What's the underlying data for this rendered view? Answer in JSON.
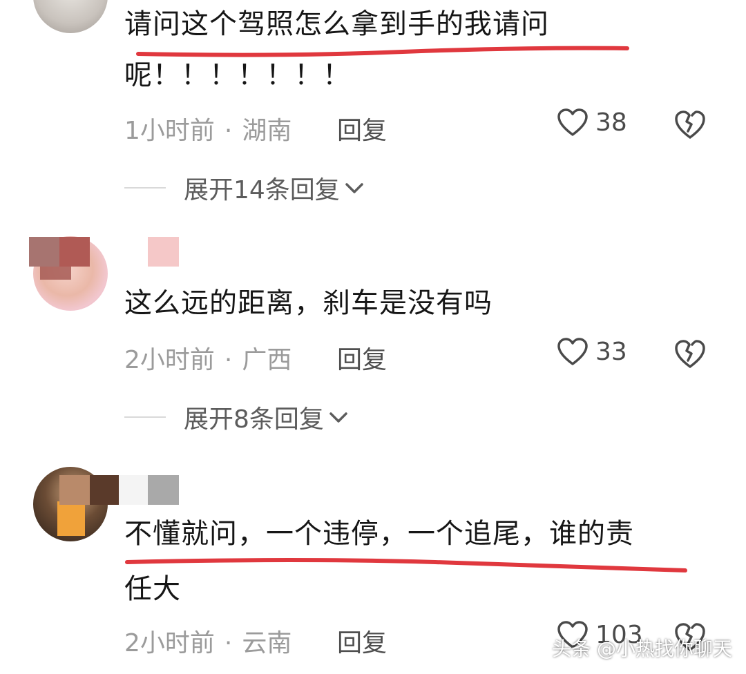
{
  "comments": [
    {
      "text_line1": "请问这个驾照怎么拿到手的我请问",
      "text_line2": "呢！！！！！！！",
      "time": "1小时前",
      "location": "湖南",
      "reply_label": "回复",
      "likes": "38",
      "expand_label": "展开14条回复"
    },
    {
      "text_line1": "这么远的距离，刹车是没有吗",
      "time": "2小时前",
      "location": "广西",
      "reply_label": "回复",
      "likes": "33",
      "expand_label": "展开8条回复"
    },
    {
      "text_line1": "不懂就问，一个违停，一个追尾，谁的责",
      "text_line2": "任大",
      "time": "2小时前",
      "location": "云南",
      "reply_label": "回复",
      "likes": "103"
    }
  ],
  "separator": "·",
  "watermark": "头条 @小热找你聊天",
  "colors": {
    "underline": "#e0383e",
    "meta": "#9b9b9b",
    "text": "#161616"
  },
  "icons": {
    "like": "heart-outline-icon",
    "dislike": "broken-heart-icon",
    "expand": "chevron-down-icon"
  }
}
